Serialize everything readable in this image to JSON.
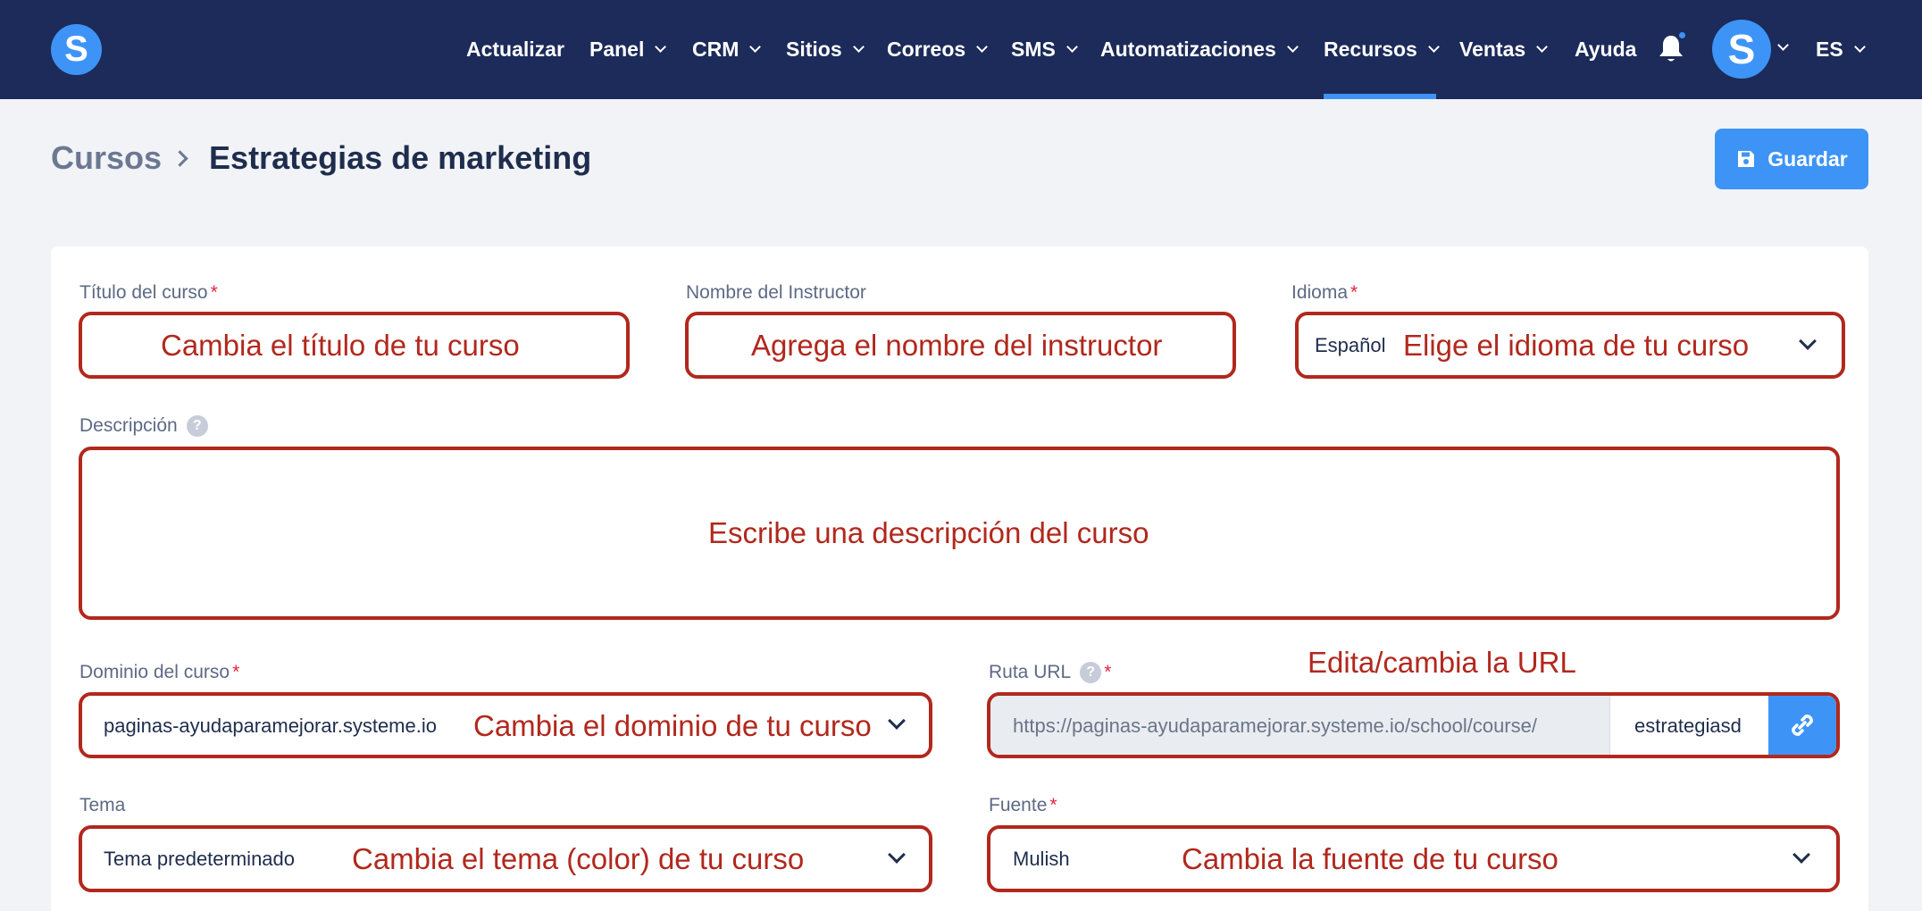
{
  "nav": {
    "logo_letter": "S",
    "items": [
      {
        "label": "Actualizar",
        "has_menu": false
      },
      {
        "label": "Panel",
        "has_menu": true
      },
      {
        "label": "CRM",
        "has_menu": true
      },
      {
        "label": "Sitios",
        "has_menu": true
      },
      {
        "label": "Correos",
        "has_menu": true
      },
      {
        "label": "SMS",
        "has_menu": true
      },
      {
        "label": "Automatizaciones",
        "has_menu": true
      },
      {
        "label": "Recursos",
        "has_menu": true,
        "active": true
      },
      {
        "label": "Ventas",
        "has_menu": true
      },
      {
        "label": "Ayuda",
        "has_menu": false
      }
    ],
    "avatar_letter": "S",
    "language": "ES"
  },
  "header": {
    "breadcrumb_parent": "Cursos",
    "title": "Estrategias de marketing",
    "save_label": "Guardar"
  },
  "form": {
    "title_field": {
      "label": "Título del curso",
      "required": "*",
      "annotation": "Cambia el título de tu curso"
    },
    "instructor_field": {
      "label": "Nombre del Instructor",
      "annotation": "Agrega el nombre del instructor"
    },
    "language_field": {
      "label": "Idioma",
      "required": "*",
      "value": "Español",
      "annotation": "Elige el idioma de tu curso"
    },
    "description_field": {
      "label": "Descripción",
      "help": "?",
      "annotation": "Escribe una descripción del curso"
    },
    "domain_field": {
      "label": "Dominio del curso",
      "required": "*",
      "value": "paginas-ayudaparamejorar.systeme.io",
      "annotation": "Cambia el dominio de tu curso"
    },
    "url_field": {
      "label": "Ruta URL",
      "help": "?",
      "required": "*",
      "prefix": "https://paginas-ayudaparamejorar.systeme.io/school/course/",
      "value": "estrategiasd",
      "annotation": "Edita/cambia la URL"
    },
    "theme_field": {
      "label": "Tema",
      "value": "Tema predeterminado",
      "annotation": "Cambia el tema (color) de tu curso"
    },
    "font_field": {
      "label": "Fuente",
      "required": "*",
      "value": "Mulish",
      "annotation": "Cambia la fuente de tu curso"
    }
  },
  "colors": {
    "nav_bg": "#1c2b59",
    "accent": "#3d94f6",
    "annotation": "#b1281d",
    "page_bg": "#f1f3f7",
    "required": "#e1253b"
  }
}
